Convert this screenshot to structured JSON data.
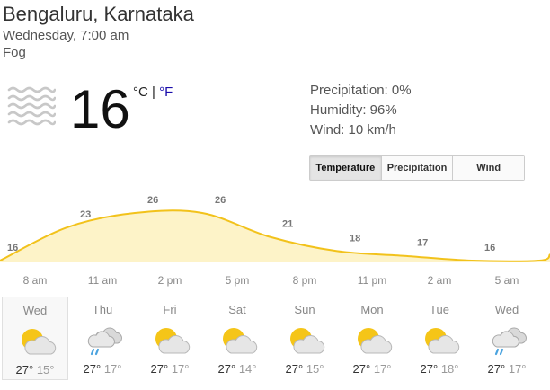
{
  "header": {
    "location": "Bengaluru, Karnataka",
    "datetime": "Wednesday, 7:00 am",
    "condition": "Fog"
  },
  "current": {
    "temperature": "16",
    "unit_c": "°C",
    "unit_sep": " | ",
    "unit_f": "°F",
    "icon": "fog-icon"
  },
  "stats": {
    "precipitation": "Precipitation: 0%",
    "humidity": "Humidity: 96%",
    "wind": "Wind: 10 km/h"
  },
  "tabs": [
    "Temperature",
    "Precipitation",
    "Wind"
  ],
  "active_tab": 0,
  "colors": {
    "line": "#f2c21b",
    "fill": "#fdf3c8",
    "link": "#1a0dab"
  },
  "chart_data": {
    "type": "area",
    "x": [
      "5 am",
      "8 am",
      "11 am",
      "2 pm",
      "5 pm",
      "8 pm",
      "11 pm",
      "2 am",
      "5 am"
    ],
    "values": [
      16,
      23,
      26,
      26,
      21,
      18,
      17,
      16,
      16
    ],
    "x_tick_labels": [
      "8 am",
      "11 am",
      "2 pm",
      "5 pm",
      "8 pm",
      "11 pm",
      "2 am",
      "5 am"
    ],
    "data_labels": [
      "16",
      "23",
      "26",
      "26",
      "21",
      "18",
      "17",
      "16"
    ],
    "ylabel": "",
    "xlabel": "",
    "grid": false
  },
  "forecast": [
    {
      "day": "Wed",
      "hi": "27°",
      "lo": "15°",
      "icon": "partly-cloudy-icon"
    },
    {
      "day": "Thu",
      "hi": "27°",
      "lo": "17°",
      "icon": "rain-cloud-icon"
    },
    {
      "day": "Fri",
      "hi": "27°",
      "lo": "17°",
      "icon": "partly-cloudy-icon"
    },
    {
      "day": "Sat",
      "hi": "27°",
      "lo": "14°",
      "icon": "partly-cloudy-icon"
    },
    {
      "day": "Sun",
      "hi": "27°",
      "lo": "15°",
      "icon": "partly-cloudy-icon"
    },
    {
      "day": "Mon",
      "hi": "27°",
      "lo": "17°",
      "icon": "partly-cloudy-icon"
    },
    {
      "day": "Tue",
      "hi": "27°",
      "lo": "18°",
      "icon": "partly-cloudy-icon"
    },
    {
      "day": "Wed",
      "hi": "27°",
      "lo": "17°",
      "icon": "rain-cloud-icon"
    }
  ],
  "selected_day": 0
}
